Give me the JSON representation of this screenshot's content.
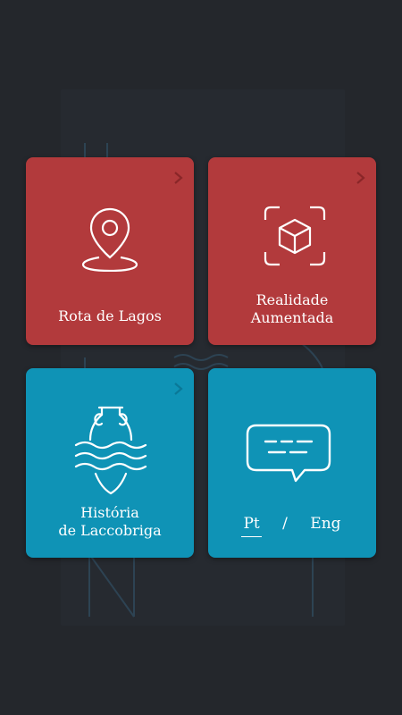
{
  "tiles": {
    "route": {
      "label": "Rota de Lagos",
      "icon": "map-pin-icon"
    },
    "ar": {
      "label_line1": "Realidade",
      "label_line2": "Aumentada",
      "icon": "ar-cube-icon"
    },
    "history": {
      "label_line1": "História",
      "label_line2": "de Laccobriga",
      "icon": "amphora-waves-icon"
    },
    "language": {
      "pt": "Pt",
      "separator": "/",
      "en": "Eng",
      "selected": "Pt",
      "icon": "speech-bubble-icon"
    }
  },
  "colors": {
    "background": "#24272c",
    "red": "#b23a3c",
    "blue": "#0f93b6",
    "text": "#ffffff"
  }
}
